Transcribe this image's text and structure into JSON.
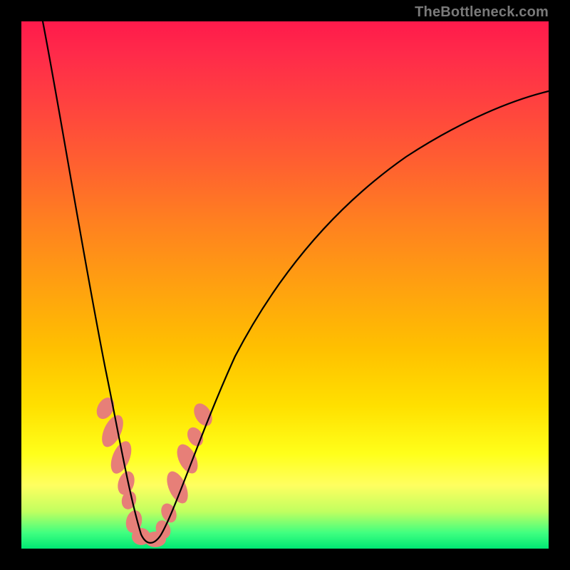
{
  "watermark": "TheBottleneck.com",
  "colors": {
    "gradient_top": "#ff1a4b",
    "gradient_bottom": "#00e874",
    "blob": "#e77f78",
    "curve": "#000000",
    "frame": "#000000"
  },
  "chart_data": {
    "type": "line",
    "title": "",
    "xlabel": "",
    "ylabel": "",
    "xlim": [
      0,
      100
    ],
    "ylim": [
      0,
      100
    ],
    "grid": false,
    "legend": false,
    "annotations": [
      "TheBottleneck.com"
    ],
    "description": "V-shaped bottleneck curve; y represents bottleneck percentage (0 = balanced, 100 = severe). Minimum of the curve occurs near x ≈ 21 (y ≈ 0).",
    "series": [
      {
        "name": "curve",
        "x": [
          1,
          3,
          5,
          7,
          9,
          11,
          13,
          15,
          17,
          19,
          21,
          23,
          25,
          27,
          30,
          35,
          40,
          45,
          50,
          55,
          60,
          65,
          70,
          75,
          80,
          85,
          90,
          95,
          100
        ],
        "y": [
          100,
          87,
          75,
          64,
          54,
          45,
          36,
          27,
          18,
          9,
          1,
          2,
          8,
          15,
          24,
          37,
          47,
          55,
          61,
          66,
          70,
          74,
          77,
          79,
          81,
          83,
          84,
          85,
          86
        ]
      },
      {
        "name": "highlight_points",
        "x": [
          15,
          16,
          17,
          17.5,
          18,
          19,
          20,
          21,
          22,
          23,
          24,
          25,
          26,
          27,
          28,
          29
        ],
        "y": [
          27,
          23,
          18,
          15,
          12,
          8,
          3,
          1,
          2,
          3,
          6,
          10,
          13,
          16,
          20,
          24
        ]
      }
    ]
  }
}
